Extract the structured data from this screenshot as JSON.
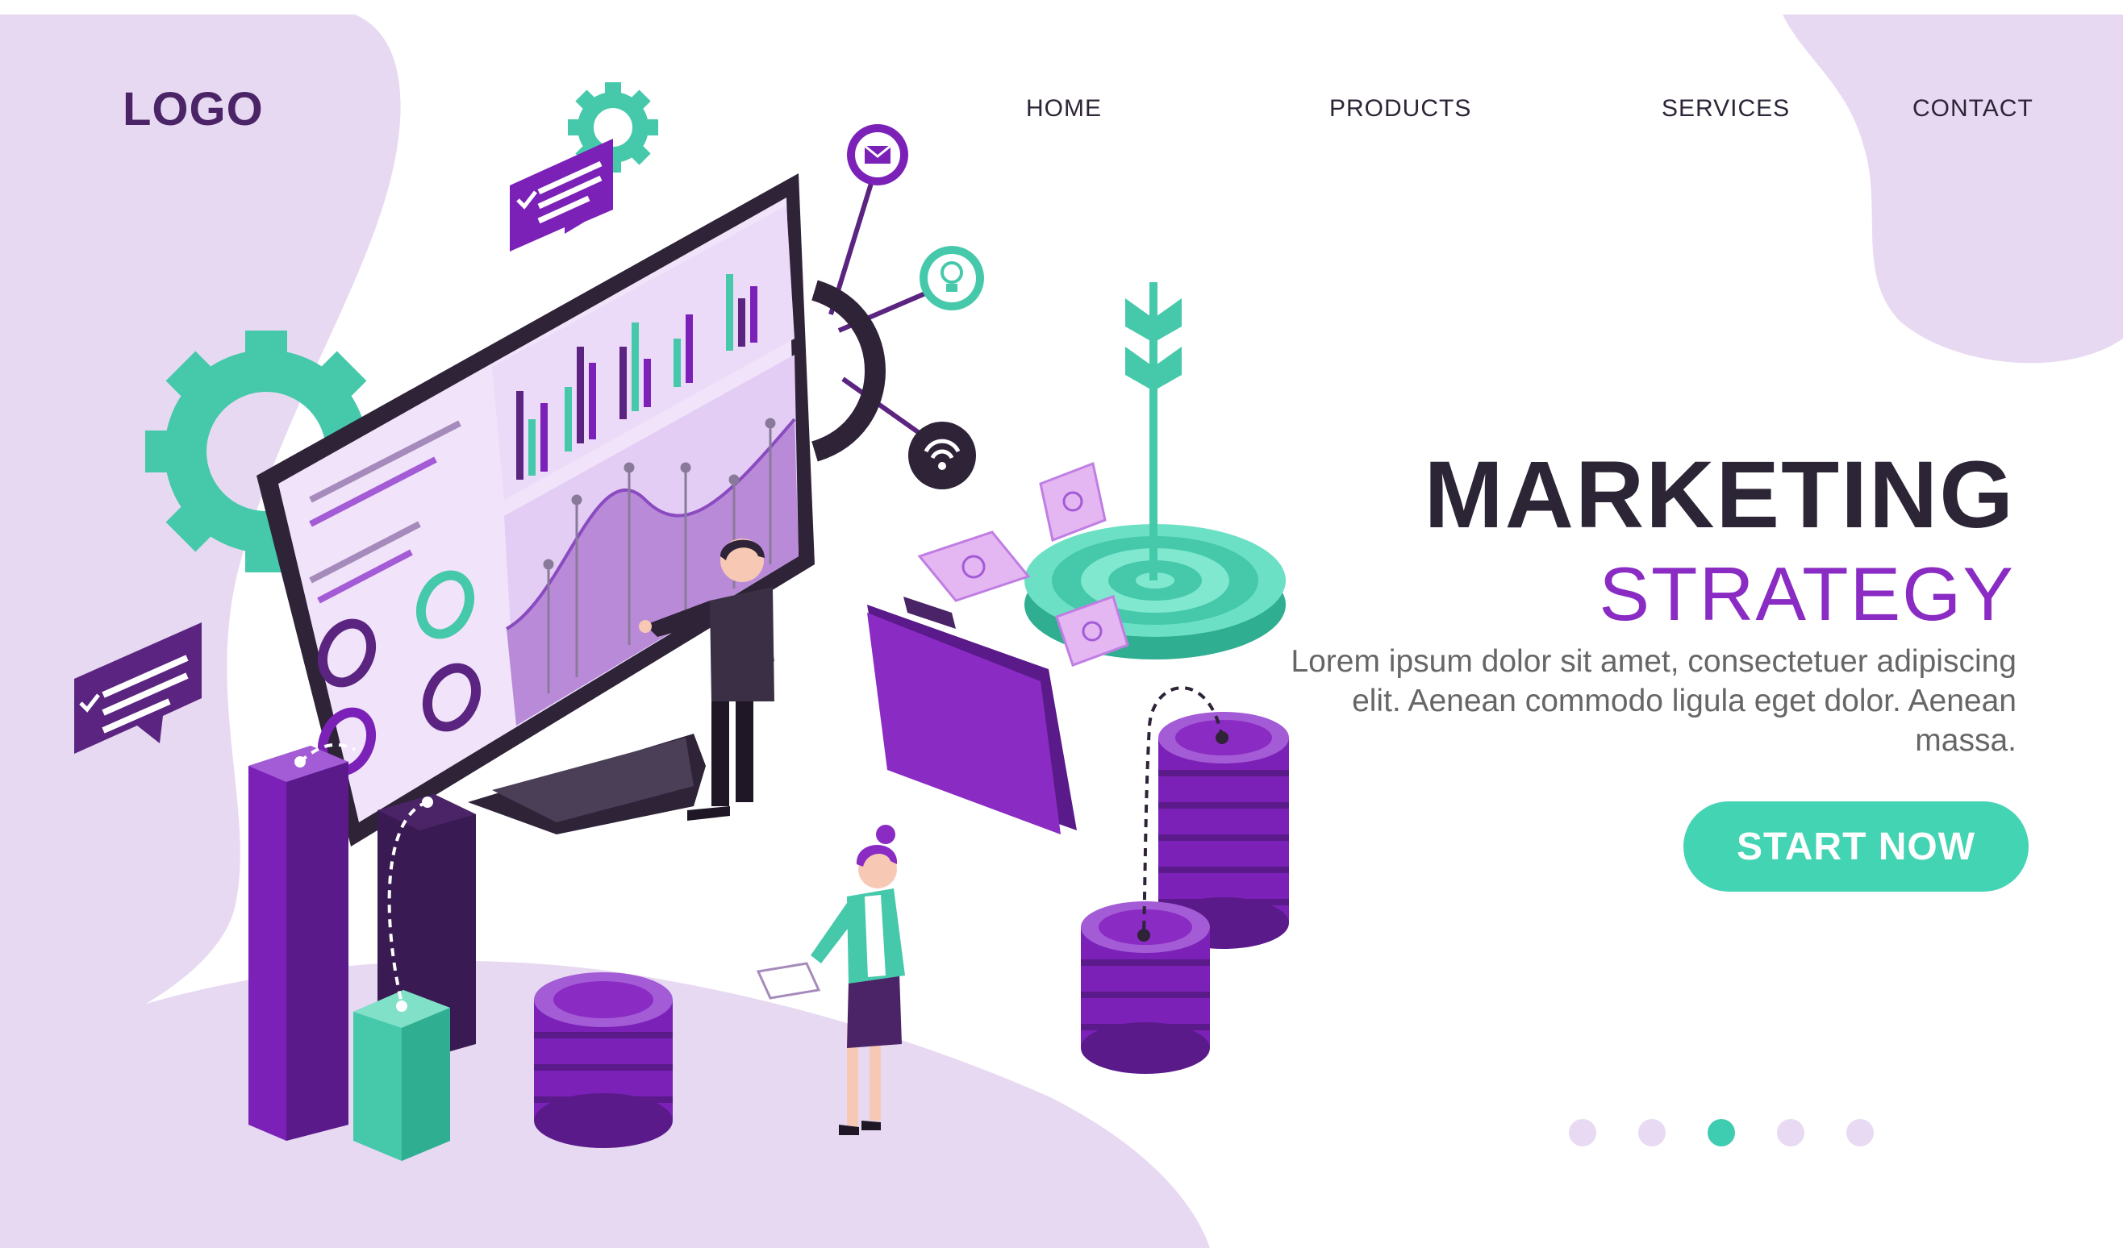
{
  "brand": {
    "logo_text": "LOGO"
  },
  "nav": {
    "items": [
      {
        "label": "HOME"
      },
      {
        "label": "PRODUCTS"
      },
      {
        "label": "SERVICES"
      },
      {
        "label": "CONTACT"
      }
    ]
  },
  "hero": {
    "title": "MARKETING",
    "subtitle": "STRATEGY",
    "description": "Lorem ipsum dolor sit amet, consectetuer adipiscing elit. Aenean commodo ligula eget dolor. Aenean massa.",
    "cta_label": "START NOW"
  },
  "carousel": {
    "count": 5,
    "active_index": 2
  },
  "colors": {
    "accent_purple": "#8a2bc4",
    "deep_purple": "#4a2466",
    "teal": "#43d4b4",
    "lavender": "#e7d9f2",
    "text_dark": "#2c2536"
  },
  "icons": [
    "gear-icon",
    "chat-bubble-icon",
    "envelope-icon",
    "lightbulb-icon",
    "wifi-icon",
    "target-icon",
    "folder-icon",
    "coin-stack-icon",
    "money-bill-icon",
    "arrow-icon"
  ]
}
